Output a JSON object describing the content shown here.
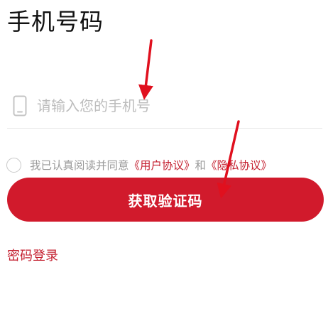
{
  "page": {
    "title": "手机号码"
  },
  "phone": {
    "placeholder": "请输入您的手机号",
    "value": "",
    "icon": "phone-icon"
  },
  "agreement": {
    "prefix": "我已认真阅读并同意",
    "user_agreement": "《用户协议》",
    "and": "和",
    "privacy_agreement": "《隐私协议》"
  },
  "actions": {
    "get_code_label": "获取验证码",
    "password_login_label": "密码登录"
  },
  "colors": {
    "brand_red": "#d11a2c",
    "link_red": "#c41f2f",
    "arrow_red": "#e0101e",
    "placeholder_gray": "#bdbdbd"
  }
}
